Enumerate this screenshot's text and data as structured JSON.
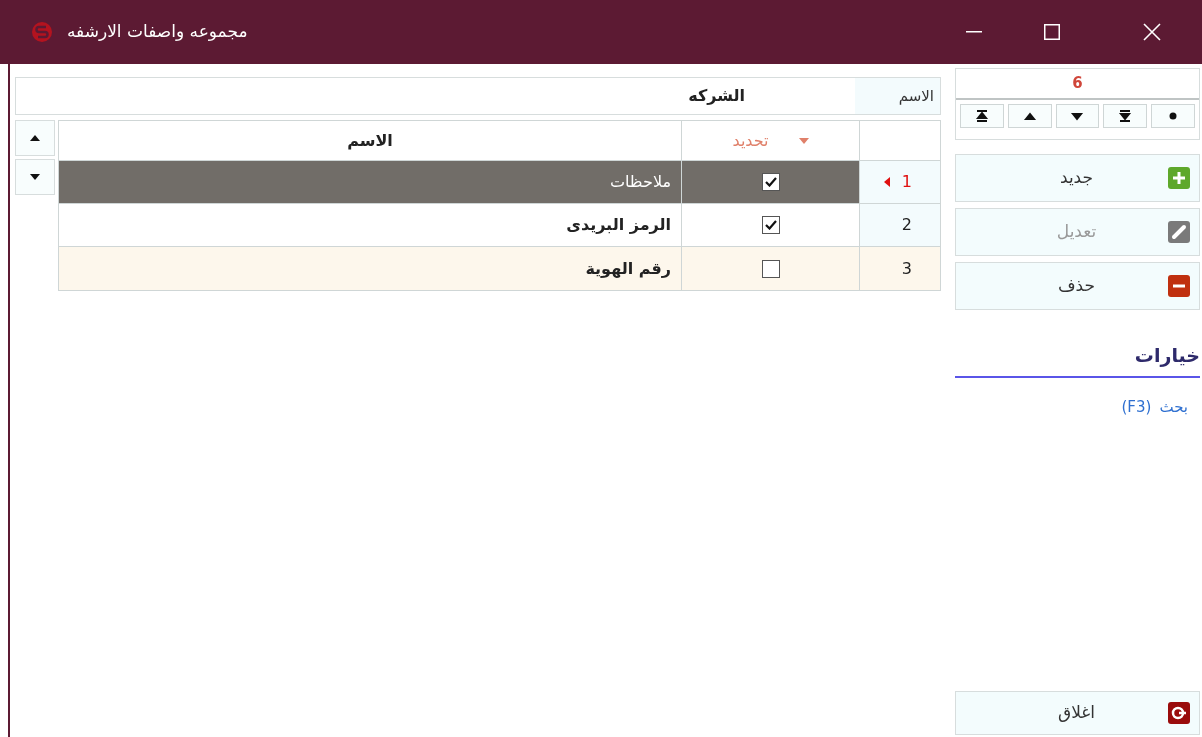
{
  "window": {
    "title": "مجموعه واصفات الارشفه"
  },
  "name_field": {
    "label": "الاسم",
    "value": "الشركه"
  },
  "grid": {
    "columns": [
      {
        "label": "تحديد",
        "sorted": true
      },
      {
        "label": "الاسم",
        "sorted": false
      }
    ],
    "rows": [
      {
        "number": "1",
        "checked": true,
        "name": "ملاحظات",
        "selected": true,
        "hovered": false
      },
      {
        "number": "2",
        "checked": true,
        "name": "الرمز البريدى",
        "selected": false,
        "hovered": false
      },
      {
        "number": "3",
        "checked": false,
        "name": "رقم الهوية",
        "selected": false,
        "hovered": true
      }
    ]
  },
  "record_nav": {
    "count": "6"
  },
  "actions": [
    {
      "label": "جديد",
      "kind": "add",
      "disabled": false
    },
    {
      "label": "تعديل",
      "kind": "edit",
      "disabled": true
    },
    {
      "label": "حذف",
      "kind": "delete",
      "disabled": false
    }
  ],
  "options": {
    "title": "خيارات",
    "links": [
      {
        "label": "بحث",
        "shortcut": "(F3)"
      }
    ]
  },
  "close_button": {
    "label": "اغلاق"
  }
}
